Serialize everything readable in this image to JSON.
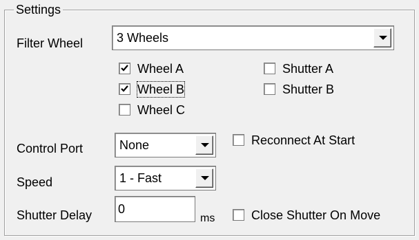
{
  "groupbox": {
    "title": "Settings"
  },
  "filter_wheel": {
    "label": "Filter Wheel",
    "selected": "3 Wheels"
  },
  "wheels": [
    {
      "label": "Wheel A",
      "checked": true
    },
    {
      "label": "Wheel B",
      "checked": true
    },
    {
      "label": "Wheel C",
      "checked": false
    }
  ],
  "shutters": [
    {
      "label": "Shutter A",
      "checked": false
    },
    {
      "label": "Shutter B",
      "checked": false
    }
  ],
  "control_port": {
    "label": "Control Port",
    "selected": "None",
    "reconnect_label": "Reconnect At Start",
    "reconnect_checked": false
  },
  "speed": {
    "label": "Speed",
    "selected": "1 - Fast"
  },
  "shutter_delay": {
    "label": "Shutter Delay",
    "value": "0",
    "unit": "ms",
    "close_on_move_label": "Close Shutter On Move",
    "close_on_move_checked": false
  }
}
